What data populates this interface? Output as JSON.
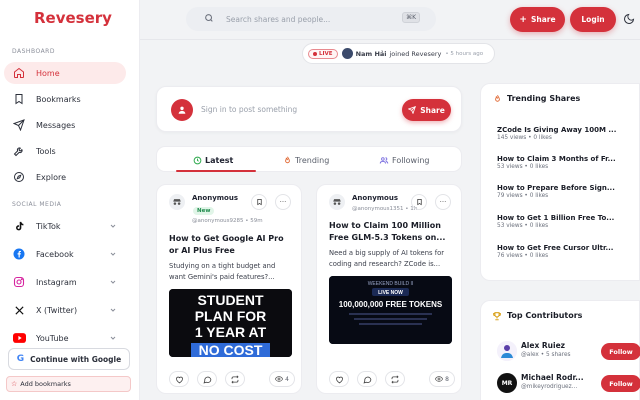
{
  "brand": "Revesery",
  "colors": {
    "accent": "#d4313b",
    "accent_soft": "#fdeaea",
    "new_green": "#1f8a4c"
  },
  "search": {
    "placeholder": "Search shares and people...",
    "shortcut": "⌘K"
  },
  "header": {
    "share_label": "Share",
    "login_label": "Login"
  },
  "sidebar": {
    "dashboard_heading": "DASHBOARD",
    "nav": [
      {
        "label": "Home",
        "icon": "home-icon",
        "active": true
      },
      {
        "label": "Bookmarks",
        "icon": "bookmark-icon"
      },
      {
        "label": "Messages",
        "icon": "send-icon"
      },
      {
        "label": "Tools",
        "icon": "wrench-icon"
      },
      {
        "label": "Explore",
        "icon": "compass-icon"
      }
    ],
    "social_heading": "SOCIAL MEDIA",
    "social": [
      {
        "label": "TikTok",
        "icon": "tiktok-icon"
      },
      {
        "label": "Facebook",
        "icon": "facebook-icon"
      },
      {
        "label": "Instagram",
        "icon": "instagram-icon"
      },
      {
        "label": "X (Twitter)",
        "icon": "x-icon"
      },
      {
        "label": "YouTube",
        "icon": "youtube-icon"
      }
    ],
    "google_button": "Continue with Google",
    "add_bookmarks": "Add bookmarks"
  },
  "live": {
    "badge": "LIVE",
    "name": "Nam Hải",
    "action": "joined Revesery",
    "time": "5 hours ago"
  },
  "composer": {
    "prompt": "Sign in to post something",
    "share_label": "Share"
  },
  "tabs": [
    {
      "label": "Latest",
      "icon": "clock-icon",
      "active": true
    },
    {
      "label": "Trending",
      "icon": "flame-icon"
    },
    {
      "label": "Following",
      "icon": "users-icon"
    }
  ],
  "posts": [
    {
      "author": "Anonymous",
      "badge": "New",
      "handle": "@anonymous9285",
      "time": "59m",
      "title": "How to Get Google AI Pro or AI Plus Free",
      "excerpt": "Studying on a tight budget and want Gemini's paid features?...",
      "thumb_lines": [
        "STUDENT",
        "PLAN FOR",
        "1 YEAR AT",
        "NO COST"
      ],
      "views": "4"
    },
    {
      "author": "Anonymous",
      "handle": "@anonymous1351",
      "time": "1h",
      "title": "How to Claim 100 Million Free GLM-5.3 Tokens on...",
      "excerpt": "Need a big supply of AI tokens for coding and research? ZCode is...",
      "thumb_lines": [
        "WEEKEND BUILD II",
        "LIVE NOW",
        "100,000,000 FREE TOKENS"
      ],
      "views": "8"
    }
  ],
  "trending": {
    "title": "Trending Shares",
    "items": [
      {
        "title": "ZCode Is Giving Away 100M ...",
        "meta": "145 views • 0 likes"
      },
      {
        "title": "How to Claim 3 Months of Fr...",
        "meta": "53 views • 0 likes"
      },
      {
        "title": "How to Prepare Before Sign...",
        "meta": "79 views • 0 likes"
      },
      {
        "title": "How to Get 1 Billion Free To...",
        "meta": "53 views • 0 likes"
      },
      {
        "title": "How to Get Free Cursor Ultr...",
        "meta": "76 views • 0 likes"
      }
    ]
  },
  "contributors": {
    "title": "Top Contributors",
    "items": [
      {
        "name": "Alex Ruiez",
        "meta": "@alex • 5 shares",
        "follow": "Follow"
      },
      {
        "name": "Michael Rodr...",
        "meta": "@mikeyrodriguez...",
        "follow": "Follow",
        "initials": "MR"
      }
    ]
  }
}
